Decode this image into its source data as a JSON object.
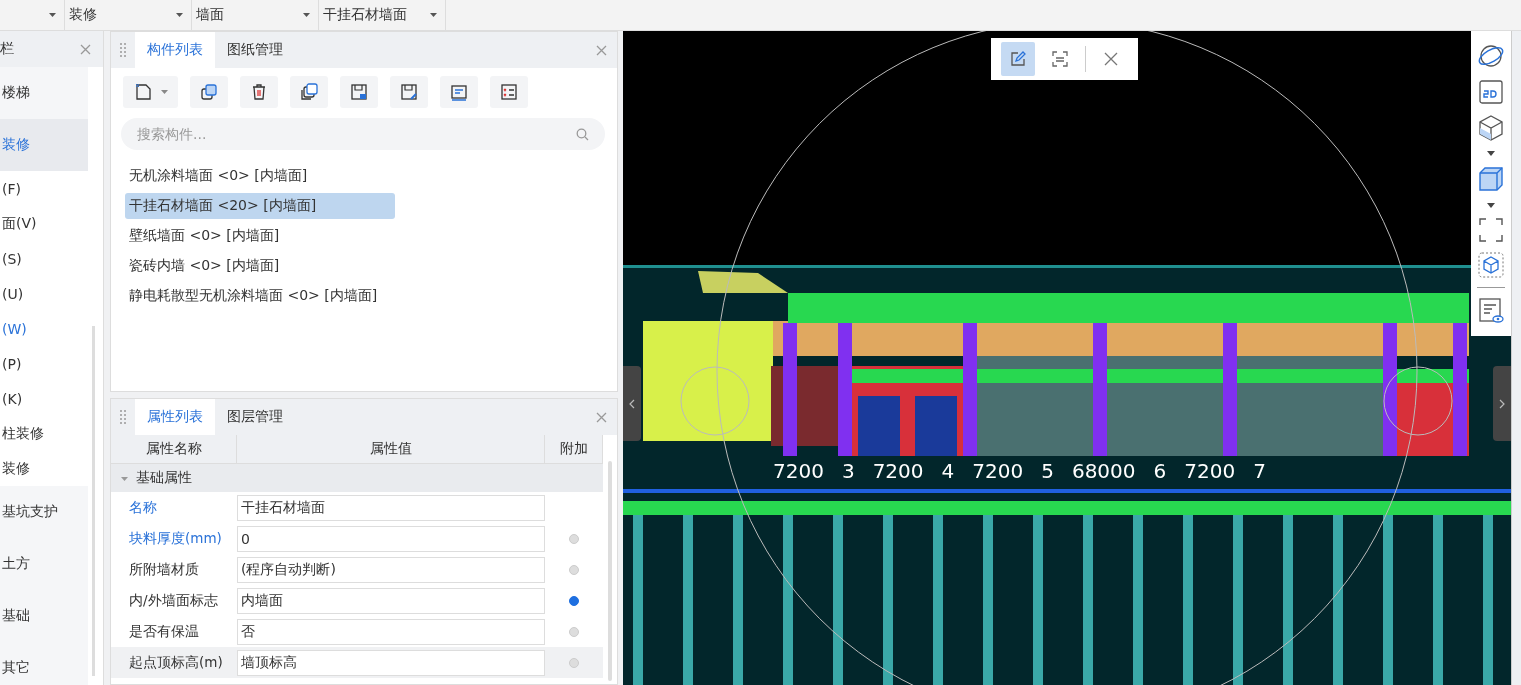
{
  "top_dropdowns": [
    {
      "label": "装修"
    },
    {
      "label": "墙面"
    },
    {
      "label": "干挂石材墙面"
    }
  ],
  "sidebar": {
    "title": "栏",
    "items": [
      {
        "label": "楼梯",
        "kind": "category",
        "selected": false
      },
      {
        "label": "装修",
        "kind": "category",
        "selected": true
      },
      {
        "label": "(F)",
        "kind": "sub",
        "selected": false
      },
      {
        "label": "面(V)",
        "kind": "sub",
        "selected": false
      },
      {
        "label": "(S)",
        "kind": "sub",
        "selected": false
      },
      {
        "label": "(U)",
        "kind": "sub",
        "selected": false
      },
      {
        "label": "(W)",
        "kind": "sub",
        "selected": true
      },
      {
        "label": "(P)",
        "kind": "sub",
        "selected": false
      },
      {
        "label": "(K)",
        "kind": "sub",
        "selected": false
      },
      {
        "label": "柱装修",
        "kind": "sub",
        "selected": false
      },
      {
        "label": "装修",
        "kind": "sub",
        "selected": false
      },
      {
        "label": "基坑支护",
        "kind": "category",
        "selected": false
      },
      {
        "label": "土方",
        "kind": "category",
        "selected": false
      },
      {
        "label": "基础",
        "kind": "category",
        "selected": false
      },
      {
        "label": "其它",
        "kind": "category",
        "selected": false
      }
    ]
  },
  "component_panel": {
    "tabs": [
      {
        "label": "构件列表",
        "selected": true
      },
      {
        "label": "图纸管理",
        "selected": false
      }
    ],
    "search": {
      "placeholder": "搜索构件..."
    },
    "items": [
      {
        "label": "无机涂料墙面 <0> [内墙面]",
        "selected": false
      },
      {
        "label": "干挂石材墙面 <20> [内墙面]",
        "selected": true
      },
      {
        "label": "壁纸墙面 <0> [内墙面]",
        "selected": false
      },
      {
        "label": "瓷砖内墙 <0> [内墙面]",
        "selected": false
      },
      {
        "label": "静电耗散型无机涂料墙面 <0> [内墙面]",
        "selected": false
      }
    ]
  },
  "property_panel": {
    "tabs": [
      {
        "label": "属性列表",
        "selected": true
      },
      {
        "label": "图层管理",
        "selected": false
      }
    ],
    "columns": [
      "属性名称",
      "属性值",
      "附加"
    ],
    "group": {
      "label": "基础属性",
      "expanded": true
    },
    "rows": [
      {
        "name": "名称",
        "value": "干挂石材墙面",
        "highlight": true
      },
      {
        "name": "块料厚度(mm)",
        "value": "0",
        "highlight": true,
        "attached": false
      },
      {
        "name": "所附墙材质",
        "value": "(程序自动判断)",
        "highlight": false,
        "attached": false
      },
      {
        "name": "内/外墙面标志",
        "value": "内墙面",
        "highlight": false,
        "attached": true
      },
      {
        "name": "是否有保温",
        "value": "否",
        "highlight": false,
        "attached": false
      },
      {
        "name": "起点顶标高(m)",
        "value": "墙顶标高",
        "highlight": false,
        "attached": false
      }
    ]
  },
  "viewport": {
    "axis_labels": [
      "7200",
      "3",
      "7200",
      "4",
      "7200",
      "5",
      "68000",
      "6",
      "7200",
      "7"
    ]
  }
}
